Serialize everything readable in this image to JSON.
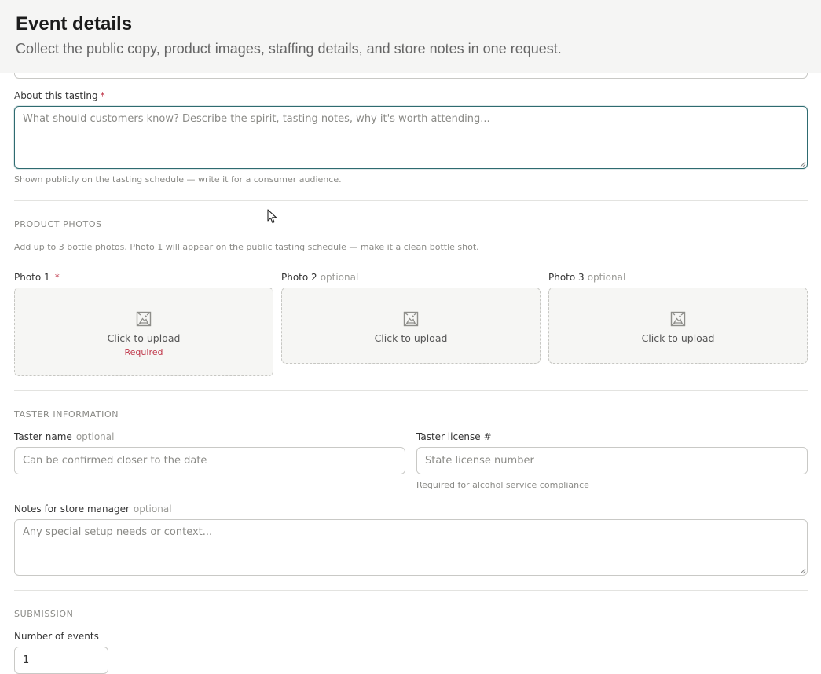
{
  "header": {
    "title": "Event details",
    "subtitle": "Collect the public copy, product images, staffing details, and store notes in one request."
  },
  "about": {
    "label": "About this tasting",
    "required_mark": "*",
    "placeholder": "What should customers know? Describe the spirit, tasting notes, why it's worth attending...",
    "value": "",
    "hint": "Shown publicly on the tasting schedule — write it for a consumer audience."
  },
  "product_photos": {
    "section_title": "PRODUCT PHOTOS",
    "description": "Add up to 3 bottle photos. Photo 1 will appear on the public tasting schedule — make it a clean bottle shot.",
    "upload_text": "Click to upload",
    "required_text": "Required",
    "photos": [
      {
        "label": "Photo 1",
        "mark": "*",
        "icon": "image-placeholder-icon"
      },
      {
        "label": "Photo 2",
        "mark": "optional",
        "icon": "image-placeholder-icon"
      },
      {
        "label": "Photo 3",
        "mark": "optional",
        "icon": "image-placeholder-icon"
      }
    ]
  },
  "taster": {
    "section_title": "TASTER INFORMATION",
    "name_label": "Taster name",
    "name_optional": "optional",
    "name_placeholder": "Can be confirmed closer to the date",
    "license_label": "Taster license #",
    "license_placeholder": "State license number",
    "license_hint": "Required for alcohol service compliance"
  },
  "notes": {
    "label": "Notes for store manager",
    "optional": "optional",
    "placeholder": "Any special setup needs or context..."
  },
  "submission": {
    "section_title": "SUBMISSION",
    "events_label": "Number of events",
    "events_value": "1"
  },
  "colors": {
    "accent": "#2e6b70",
    "required": "#c0384b",
    "muted": "#8a8a86",
    "header_bg": "#f5f5f4"
  }
}
